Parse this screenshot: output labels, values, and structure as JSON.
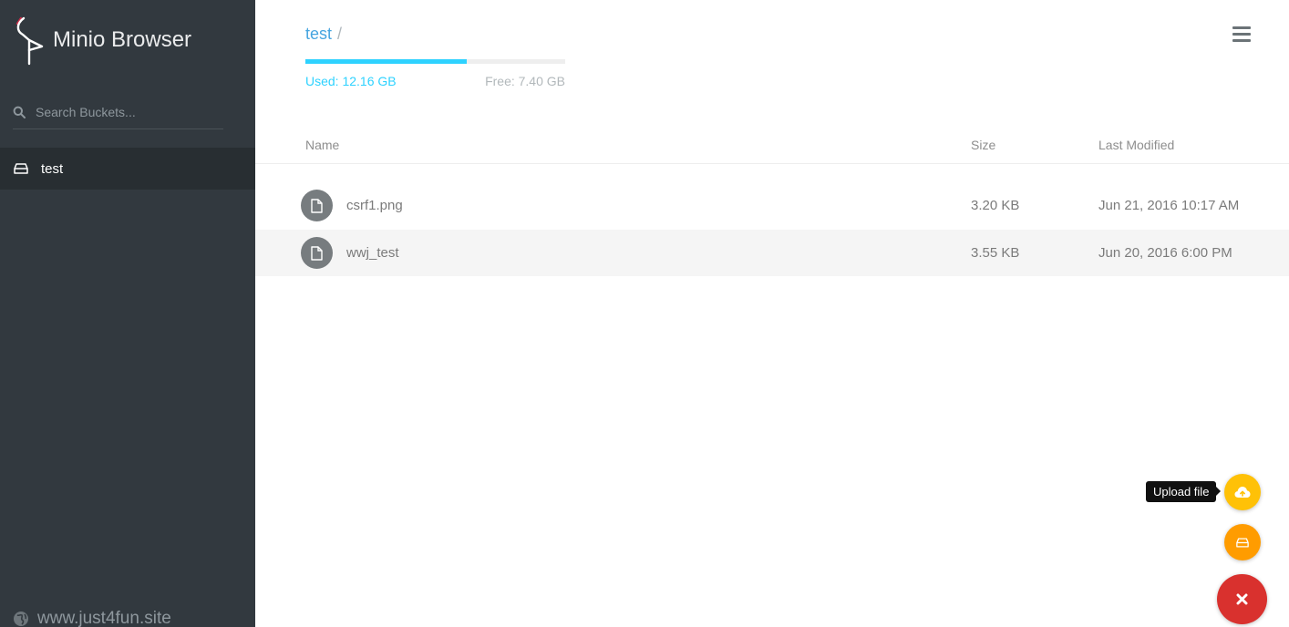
{
  "app": {
    "title": "Minio Browser"
  },
  "sidebar": {
    "search_placeholder": "Search Buckets...",
    "buckets": [
      {
        "label": "test",
        "active": true
      }
    ],
    "footer_host": "www.just4fun.site"
  },
  "breadcrumb": {
    "bucket": "test",
    "separator": "/"
  },
  "storage": {
    "used_label": "Used: 12.16 GB",
    "free_label": "Free: 7.40 GB",
    "used_fraction": 0.62,
    "bar_color": "#2ed2ff"
  },
  "table": {
    "headers": {
      "name": "Name",
      "size": "Size",
      "modified": "Last Modified"
    },
    "rows": [
      {
        "name": "csrf1.png",
        "size": "3.20 KB",
        "modified": "Jun 21, 2016 10:17 AM",
        "icon": "file-icon"
      },
      {
        "name": "wwj_test",
        "size": "3.55 KB",
        "modified": "Jun 20, 2016 6:00 PM",
        "icon": "file-icon"
      }
    ]
  },
  "actions": {
    "upload_tooltip": "Upload file",
    "upload_icon": "cloud-upload-icon",
    "create_bucket_icon": "drive-icon",
    "close_icon": "close-icon",
    "colors": {
      "upload": "#ffc107",
      "bucket": "#ff9c00",
      "close": "#d9312e"
    }
  },
  "colors": {
    "sidebar": "#32393f",
    "accent": "#46a5e0"
  }
}
